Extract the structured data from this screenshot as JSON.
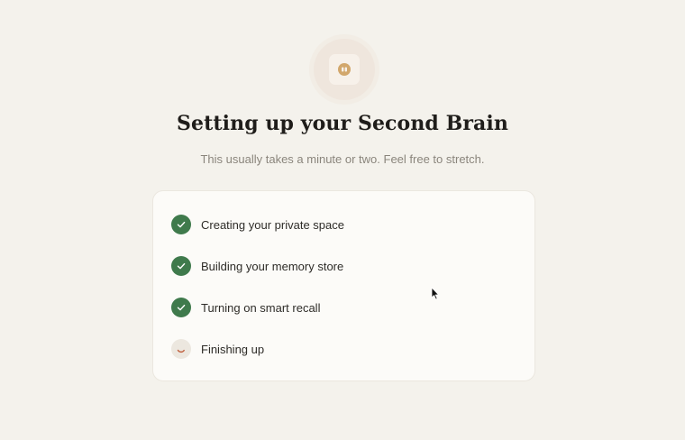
{
  "header": {
    "logo_icon": "brain-icon",
    "title": "Setting up your Second Brain",
    "subtitle": "This usually takes a minute or two. Feel free to stretch."
  },
  "steps": [
    {
      "label": "Creating your private space",
      "status": "done",
      "icon": "check-icon"
    },
    {
      "label": "Building your memory store",
      "status": "done",
      "icon": "check-icon"
    },
    {
      "label": "Turning on smart recall",
      "status": "done",
      "icon": "check-icon"
    },
    {
      "label": "Finishing up",
      "status": "in-progress",
      "icon": "spinner-icon"
    }
  ],
  "colors": {
    "background": "#f4f2ec",
    "card": "#fcfbf8",
    "done": "#3f7a4c",
    "spinner": "#c0603f",
    "logo_accent": "#d2a76c"
  }
}
